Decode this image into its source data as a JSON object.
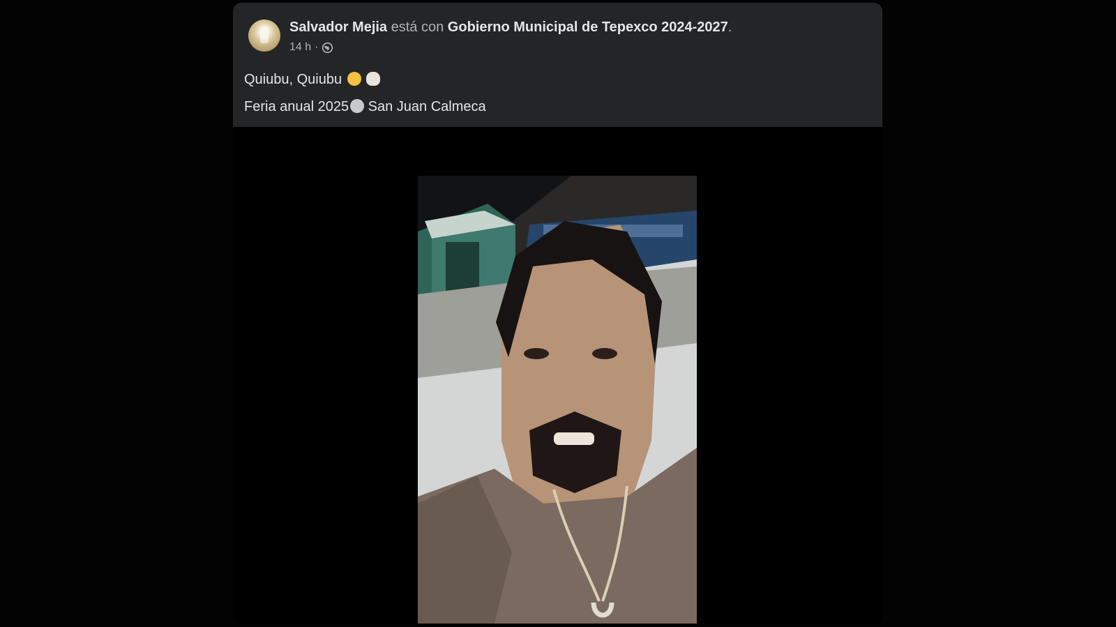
{
  "post": {
    "author": "Salvador Mejia",
    "connector": "está con",
    "tagged_page": "Gobierno Municipal de Tepexco 2024-2027",
    "title_end": ".",
    "time": "14 h",
    "separator": "·",
    "audience_icon": "globe-icon",
    "text_line1": "Quiubu, Quiubu",
    "text_line1_emojis": [
      "smiling-face-icon",
      "ghost-icon"
    ],
    "text_line2_before": "Feria anual 2025",
    "text_line2_emoji": "ferris-wheel-icon",
    "text_line2_after": " San Juan Calmeca"
  },
  "media": {
    "type": "video",
    "description_icon": "video-frame"
  },
  "colors": {
    "page_bg": "#030303",
    "header_bg": "#242526",
    "primary_text": "#e4e6eb",
    "secondary_text": "#b0b3b8"
  }
}
